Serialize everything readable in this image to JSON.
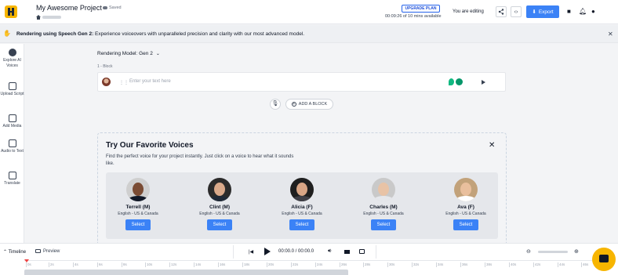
{
  "header": {
    "project_title": "My Awesome Project",
    "saved_label": "Saved",
    "upgrade_label": "UPGRADE PLAN",
    "time_available": "00:09:26 of 10 mins available",
    "editing_label": "You are editing",
    "export_label": "Export"
  },
  "banner": {
    "bold_text": "Rendering using Speech Gen 2:",
    "text": " Experience voiceovers with unparalleled precision and clarity with our most advanced model."
  },
  "sidebar": {
    "items": [
      {
        "label": "Explore AI Voices",
        "icon": "avatar-icon"
      },
      {
        "label": "Upload Script",
        "icon": "upload-icon"
      },
      {
        "label": "Add Media",
        "icon": "media-icon"
      },
      {
        "label": "Audio to Text",
        "icon": "audio-to-text-icon"
      },
      {
        "label": "Translate",
        "icon": "translate-icon"
      }
    ]
  },
  "editor": {
    "model_label": "Rendering Model: Gen 2",
    "block_label": "1 -  Block",
    "text_placeholder": "Enter your text here",
    "add_block_label": "ADD A BLOCK"
  },
  "voices_panel": {
    "title": "Try Our Favorite Voices",
    "description": "Find the perfect voice for your project instantly. Just click on a voice to hear what it sounds like.",
    "voices": [
      {
        "name": "Terrell (M)",
        "accent": "English - US & Canada",
        "select": "Select",
        "skin": "#7a4b33",
        "shirt": "#111827",
        "bg": "#cfcfcf"
      },
      {
        "name": "Clint (M)",
        "accent": "English - US & Canada",
        "select": "Select",
        "skin": "#d9a98a",
        "shirt": "#1f2937",
        "bg": "#2b2b2b"
      },
      {
        "name": "Alicia (F)",
        "accent": "English - US & Canada",
        "select": "Select",
        "skin": "#d8a585",
        "shirt": "#3f3f46",
        "bg": "#1f1f1f"
      },
      {
        "name": "Charles (M)",
        "accent": "English - US & Canada",
        "select": "Select",
        "skin": "#e8c3a6",
        "shirt": "#e5e7eb",
        "bg": "#c9c9c9"
      },
      {
        "name": "Ava (F)",
        "accent": "English - US & Canada",
        "select": "Select",
        "skin": "#e9bf9d",
        "shirt": "#ffffff",
        "bg": "#c2a27a"
      }
    ]
  },
  "bottom": {
    "timeline_label": "Timeline",
    "preview_label": "Preview",
    "time_display": "00:00.0 / 00:00.0",
    "ruler": [
      "0s",
      "2s",
      "4s",
      "6s",
      "8s",
      "10s",
      "12s",
      "14s",
      "16s",
      "18s",
      "20s",
      "22s",
      "24s",
      "26s",
      "28s",
      "30s",
      "32s",
      "34s",
      "36s",
      "38s",
      "40s",
      "42s",
      "44s",
      "46s"
    ]
  },
  "colors": {
    "accent": "#3b82f6",
    "brand": "#f7b500"
  }
}
